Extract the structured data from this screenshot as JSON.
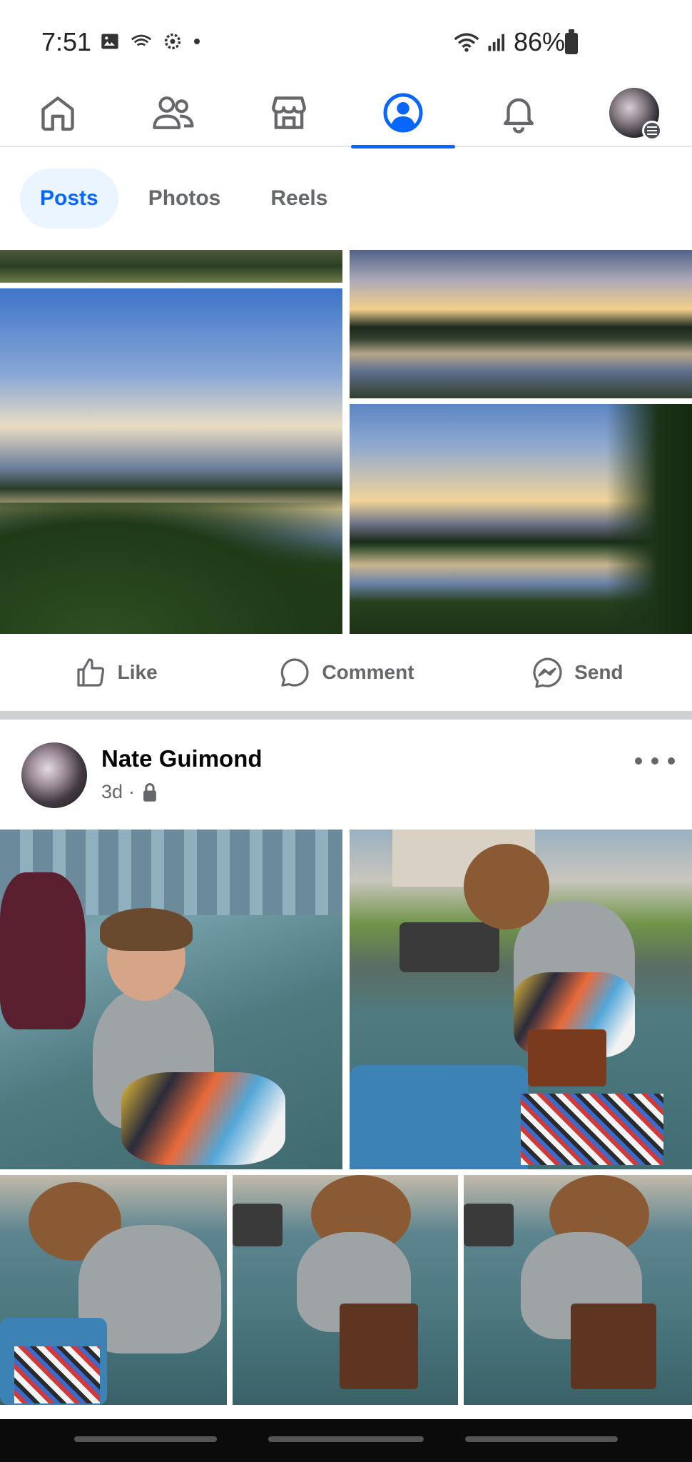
{
  "status_bar": {
    "time": "7:51",
    "battery": "86%"
  },
  "nav": {
    "items": [
      {
        "name": "home",
        "icon": "home-icon",
        "active": false
      },
      {
        "name": "friends",
        "icon": "friends-icon",
        "active": false
      },
      {
        "name": "marketplace",
        "icon": "marketplace-icon",
        "active": false
      },
      {
        "name": "profile",
        "icon": "profile-icon",
        "active": true
      },
      {
        "name": "notifications",
        "icon": "bell-icon",
        "active": false
      },
      {
        "name": "menu",
        "icon": "avatar-menu-icon",
        "active": false
      }
    ],
    "accent_color": "#0866ff"
  },
  "tabs": [
    {
      "label": "Posts",
      "active": true
    },
    {
      "label": "Photos",
      "active": false
    },
    {
      "label": "Reels",
      "active": false
    }
  ],
  "actions": {
    "like_label": "Like",
    "comment_label": "Comment",
    "send_label": "Send"
  },
  "post": {
    "author": "Nate Guimond",
    "age": "3d",
    "separator": "·",
    "privacy_icon": "lock-icon"
  }
}
